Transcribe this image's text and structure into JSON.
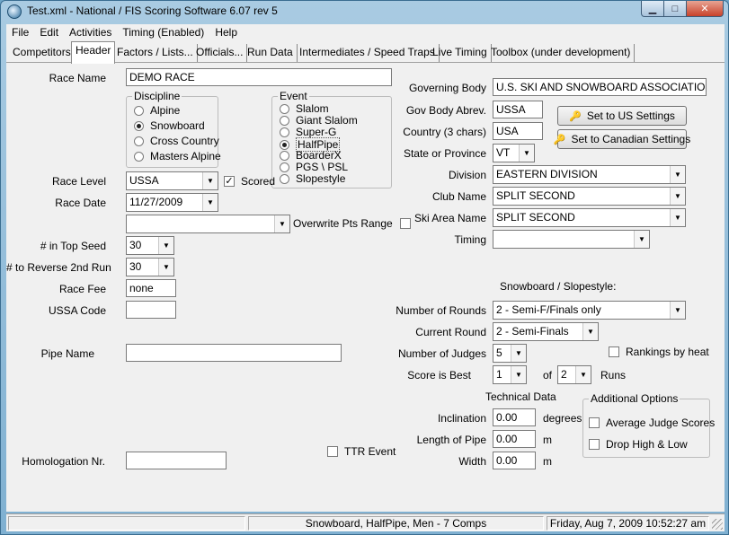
{
  "window": {
    "title": "Test.xml - National / FIS Scoring Software 6.07 rev 5",
    "min_label": "▁",
    "max_label": "□",
    "close_label": "✕"
  },
  "menu": [
    "File",
    "Edit",
    "Activities",
    "Timing (Enabled)",
    "Help"
  ],
  "tabs": [
    "Competitors",
    "Header",
    "Factors / Lists...",
    "Officials...",
    "Run Data",
    "Intermediates / Speed Traps",
    "Live Timing",
    "Toolbox (under development)"
  ],
  "left": {
    "race_name_label": "Race Name",
    "race_name_value": "DEMO RACE",
    "discipline_title": "Discipline",
    "disciplines": [
      "Alpine",
      "Snowboard",
      "Cross Country",
      "Masters Alpine"
    ],
    "event_title": "Event",
    "events": [
      "Slalom",
      "Giant Slalom",
      "Super-G",
      "HalfPipe",
      "BoarderX",
      "PGS \\ PSL",
      "Slopestyle"
    ],
    "race_level_label": "Race Level",
    "race_level_value": "USSA",
    "scored_label": "Scored",
    "race_date_label": "Race Date",
    "race_date_value": "11/27/2009",
    "pts_range_value": "",
    "overwrite_label": "Overwrite Pts Range",
    "top_seed_label": "# in Top Seed",
    "top_seed_value": "30",
    "reverse_label": "# to Reverse 2nd Run",
    "reverse_value": "30",
    "race_fee_label": "Race Fee",
    "race_fee_value": "none",
    "ussa_code_label": "USSA Code",
    "ussa_code_value": "",
    "pipe_name_label": "Pipe Name",
    "pipe_name_value": "",
    "homologation_label": "Homologation Nr.",
    "homologation_value": "",
    "ttr_label": "TTR Event"
  },
  "right": {
    "governing_body_label": "Governing Body",
    "governing_body_value": "U.S. SKI AND SNOWBOARD ASSOCIATION",
    "gov_abbrev_label": "Gov Body Abrev.",
    "gov_abbrev_value": "USSA",
    "country_label": "Country (3 chars)",
    "country_value": "USA",
    "state_label": "State or Province",
    "state_value": "VT",
    "set_us_button": "Set to US Settings",
    "set_ca_button": "Set to Canadian Settings",
    "division_label": "Division",
    "division_value": "EASTERN DIVISION",
    "club_label": "Club Name",
    "club_value": "SPLIT SECOND",
    "ski_area_label": "Ski Area Name",
    "ski_area_value": "SPLIT SECOND",
    "timing_label": "Timing",
    "timing_value": "",
    "section_title": "Snowboard / Slopestyle:",
    "rounds_label": "Number of Rounds",
    "rounds_value": "2 - Semi-F/Finals only",
    "current_round_label": "Current Round",
    "current_round_value": "2 - Semi-Finals",
    "judges_label": "Number of Judges",
    "judges_value": "5",
    "rankings_label": "Rankings by heat",
    "best_label": "Score is Best",
    "best_value": "1",
    "of_label": "of",
    "runs_value": "2",
    "runs_label": "Runs",
    "tech_title": "Technical Data",
    "inclination_label": "Inclination",
    "inclination_value": "0.00",
    "inclination_unit": "degrees",
    "length_label": "Length of Pipe",
    "length_value": "0.00",
    "length_unit": "m",
    "width_label": "Width",
    "width_value": "0.00",
    "width_unit": "m",
    "options_title": "Additional Options",
    "avg_judge_label": "Average Judge Scores",
    "drop_label": "Drop High & Low"
  },
  "status": {
    "cell1": "",
    "summary": "Snowboard, HalfPipe, Men - 7 Comps",
    "datetime": "Friday, Aug 7, 2009  10:52:27 am"
  }
}
